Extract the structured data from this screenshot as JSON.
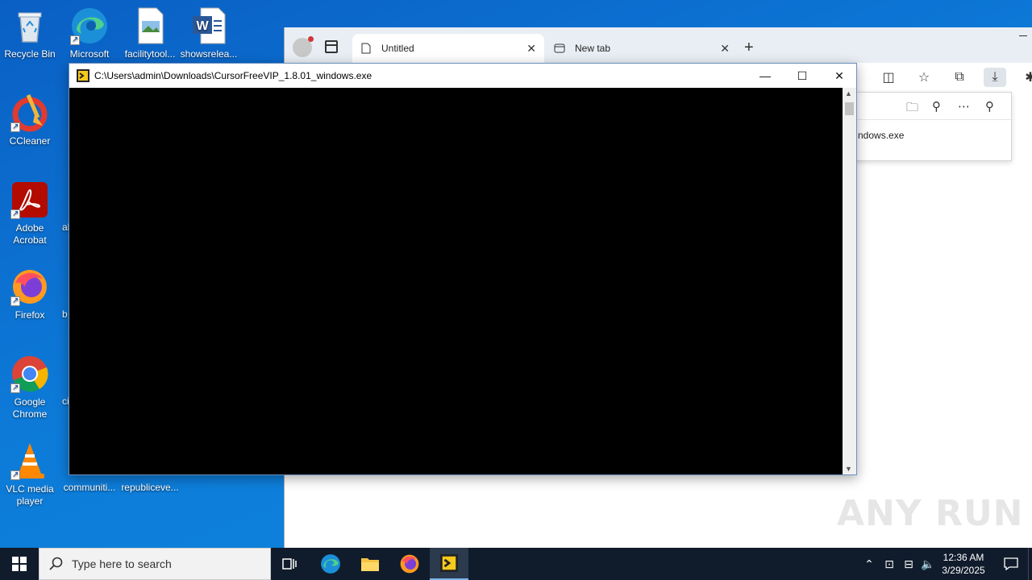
{
  "desktop": {
    "icons": [
      {
        "label": "Recycle Bin"
      },
      {
        "label": "Microsoft Edge"
      },
      {
        "label": "facilitytool..."
      },
      {
        "label": "showsrelea..."
      },
      {
        "label": "CCleaner"
      },
      {
        "label": "Adobe Acrobat"
      },
      {
        "label": "Firefox"
      },
      {
        "label": "Google Chrome"
      },
      {
        "label": "VLC media player"
      },
      {
        "label": "communiti..."
      },
      {
        "label": "republiceve..."
      }
    ],
    "partial_labels": [
      "al",
      "b",
      "ci"
    ]
  },
  "edge": {
    "tabs": [
      {
        "label": "Untitled"
      },
      {
        "label": "New tab"
      }
    ],
    "download_panel": {
      "filename_partial": "ndows.exe"
    }
  },
  "console": {
    "title": "C:\\Users\\admin\\Downloads\\CursorFreeVIP_1.8.01_windows.exe"
  },
  "taskbar": {
    "search_placeholder": "Type here to search",
    "time": "12:36 AM",
    "date": "3/29/2025"
  },
  "watermark": "ANY RUN"
}
